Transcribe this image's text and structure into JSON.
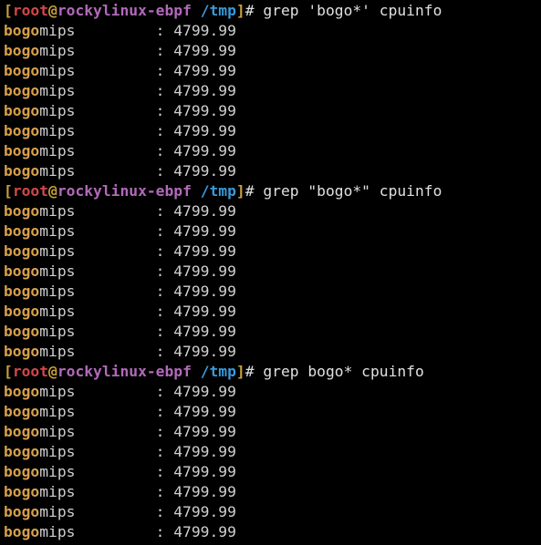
{
  "prompt": {
    "open_bracket": "[",
    "user": "root",
    "at": "@",
    "host": "rockylinux-ebpf",
    "dir": "/tmp",
    "close_bracket": "]",
    "symbol": "# "
  },
  "blocks": [
    {
      "command": "grep 'bogo*' cpuinfo",
      "lines": [
        {
          "match": "bogo",
          "rest": "mips         : 4799.99"
        },
        {
          "match": "bogo",
          "rest": "mips         : 4799.99"
        },
        {
          "match": "bogo",
          "rest": "mips         : 4799.99"
        },
        {
          "match": "bogo",
          "rest": "mips         : 4799.99"
        },
        {
          "match": "bogo",
          "rest": "mips         : 4799.99"
        },
        {
          "match": "bogo",
          "rest": "mips         : 4799.99"
        },
        {
          "match": "bogo",
          "rest": "mips         : 4799.99"
        },
        {
          "match": "bogo",
          "rest": "mips         : 4799.99"
        }
      ]
    },
    {
      "command": "grep \"bogo*\" cpuinfo",
      "lines": [
        {
          "match": "bogo",
          "rest": "mips         : 4799.99"
        },
        {
          "match": "bogo",
          "rest": "mips         : 4799.99"
        },
        {
          "match": "bogo",
          "rest": "mips         : 4799.99"
        },
        {
          "match": "bogo",
          "rest": "mips         : 4799.99"
        },
        {
          "match": "bogo",
          "rest": "mips         : 4799.99"
        },
        {
          "match": "bogo",
          "rest": "mips         : 4799.99"
        },
        {
          "match": "bogo",
          "rest": "mips         : 4799.99"
        },
        {
          "match": "bogo",
          "rest": "mips         : 4799.99"
        }
      ]
    },
    {
      "command": "grep bogo* cpuinfo",
      "lines": [
        {
          "match": "bogo",
          "rest": "mips         : 4799.99"
        },
        {
          "match": "bogo",
          "rest": "mips         : 4799.99"
        },
        {
          "match": "bogo",
          "rest": "mips         : 4799.99"
        },
        {
          "match": "bogo",
          "rest": "mips         : 4799.99"
        },
        {
          "match": "bogo",
          "rest": "mips         : 4799.99"
        },
        {
          "match": "bogo",
          "rest": "mips         : 4799.99"
        },
        {
          "match": "bogo",
          "rest": "mips         : 4799.99"
        },
        {
          "match": "bogo",
          "rest": "mips         : 4799.99"
        }
      ]
    }
  ]
}
